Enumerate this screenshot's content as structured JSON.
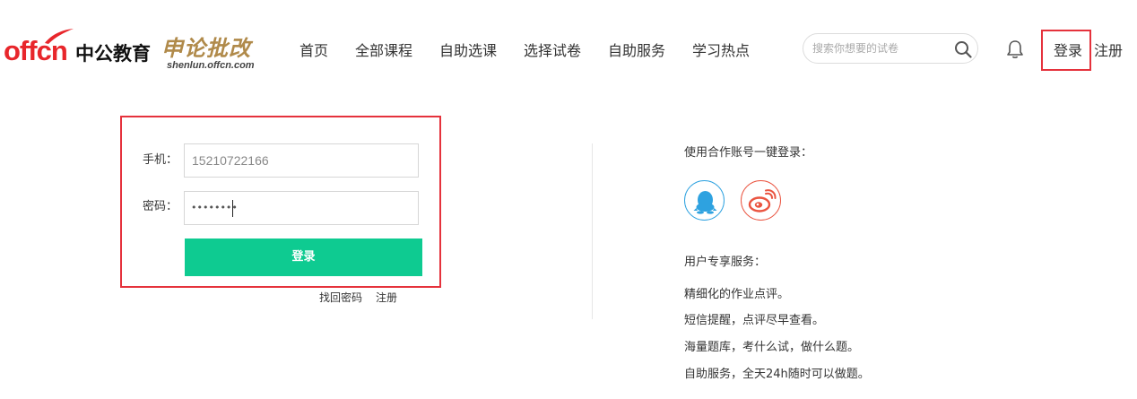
{
  "header": {
    "brand_offcn": "offcn",
    "brand_cn": "中公教育",
    "sub_brand": "申论批改",
    "sub_brand_url": "shenlun.offcn.com",
    "nav": [
      "首页",
      "全部课程",
      "自助选课",
      "选择试卷",
      "自助服务",
      "学习热点"
    ],
    "search_placeholder": "搜索你想要的试卷",
    "login": "登录",
    "register": "注册"
  },
  "form": {
    "phone_label": "手机：",
    "phone_value": "15210722166",
    "password_label": "密码：",
    "password_dots": "••••••••",
    "submit": "登录",
    "forgot": "找回密码",
    "register": "注册"
  },
  "side": {
    "partner_login": "使用合作账号一键登录：",
    "services_title": "用户专享服务：",
    "services": [
      "精细化的作业点评。",
      "短信提醒，点评尽早查看。",
      "海量题库，考什么试，做什么题。",
      "自助服务，全天24h随时可以做题。"
    ]
  },
  "colors": {
    "brand_red": "#e8262b",
    "highlight_red": "#e5323c",
    "button_green": "#0ecb91",
    "qq_blue": "#2ea2e0",
    "weibo_red": "#ea5440"
  },
  "icons": [
    "search-icon",
    "bell-icon",
    "qq-icon",
    "weibo-icon"
  ]
}
